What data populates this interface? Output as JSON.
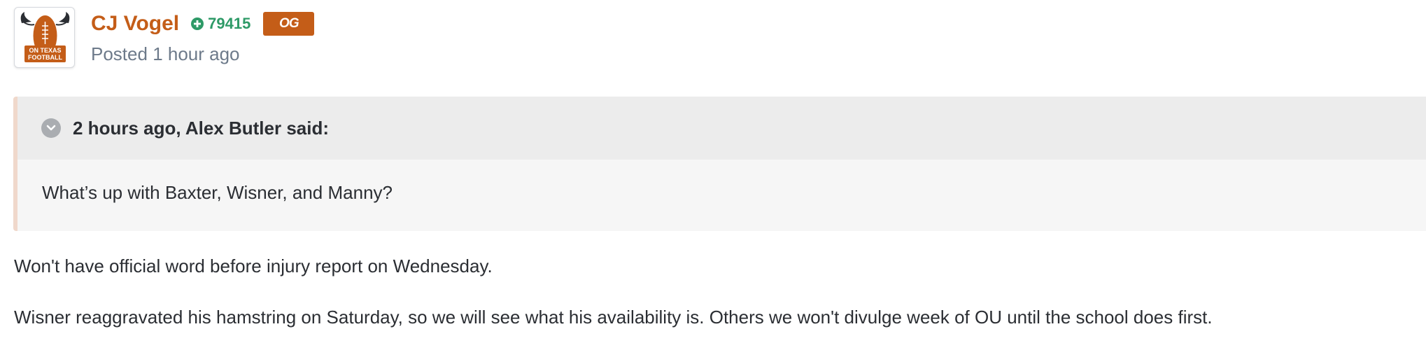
{
  "post": {
    "author": {
      "name": "CJ Vogel",
      "reputation": "79415",
      "reputation_icon": "plus-circle-icon",
      "badge": "OG",
      "avatar_text_line1": "ON TEXAS",
      "avatar_text_line2": "FOOTBALL"
    },
    "posted_prefix": "Posted",
    "posted_time": "1 hour ago",
    "quote": {
      "citation": "2 hours ago, Alex Butler said:",
      "text": "What’s up with Baxter, Wisner, and Manny?",
      "toggle_icon": "chevron-down-icon"
    },
    "paragraphs": [
      "Won't have official word before injury report on Wednesday.",
      "Wisner reaggravated his hamstring on Saturday, so we will see what his availability is. Others we won't divulge week of OU until the school does first."
    ]
  },
  "colors": {
    "author": "#c45d18",
    "reputation": "#2e9a67",
    "badge_bg": "#c45d18",
    "quote_border": "#f0d8cb",
    "quote_head_bg": "#ececec",
    "quote_body_bg": "#f6f6f6",
    "meta_text": "#6d7a8a"
  }
}
